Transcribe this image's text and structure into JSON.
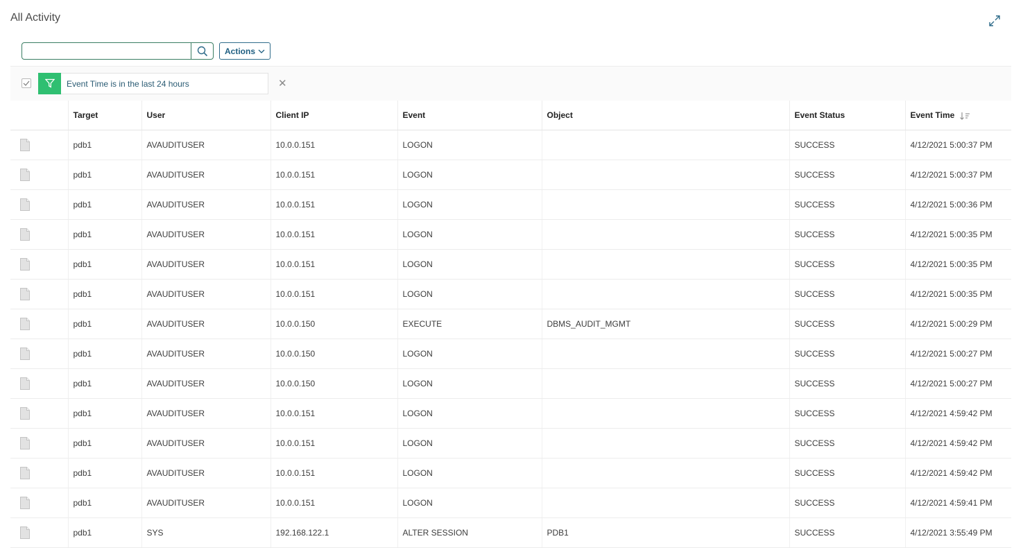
{
  "page": {
    "title": "All Activity"
  },
  "search": {
    "value": "",
    "placeholder": ""
  },
  "actions": {
    "label": "Actions"
  },
  "filter": {
    "text": "Event Time is in the last 24 hours",
    "accent_color": "#2fbf71"
  },
  "table": {
    "columns": [
      "",
      "Target",
      "User",
      "Client IP",
      "Event",
      "Object",
      "Event Status",
      "Event Time"
    ],
    "sorted_column": "Event Time",
    "sort_direction": "descending",
    "rows": [
      {
        "target": "pdb1",
        "user": "AVAUDITUSER",
        "client_ip": "10.0.0.151",
        "event": "LOGON",
        "object": "",
        "status": "SUCCESS",
        "time": "4/12/2021 5:00:37 PM"
      },
      {
        "target": "pdb1",
        "user": "AVAUDITUSER",
        "client_ip": "10.0.0.151",
        "event": "LOGON",
        "object": "",
        "status": "SUCCESS",
        "time": "4/12/2021 5:00:37 PM"
      },
      {
        "target": "pdb1",
        "user": "AVAUDITUSER",
        "client_ip": "10.0.0.151",
        "event": "LOGON",
        "object": "",
        "status": "SUCCESS",
        "time": "4/12/2021 5:00:36 PM"
      },
      {
        "target": "pdb1",
        "user": "AVAUDITUSER",
        "client_ip": "10.0.0.151",
        "event": "LOGON",
        "object": "",
        "status": "SUCCESS",
        "time": "4/12/2021 5:00:35 PM"
      },
      {
        "target": "pdb1",
        "user": "AVAUDITUSER",
        "client_ip": "10.0.0.151",
        "event": "LOGON",
        "object": "",
        "status": "SUCCESS",
        "time": "4/12/2021 5:00:35 PM"
      },
      {
        "target": "pdb1",
        "user": "AVAUDITUSER",
        "client_ip": "10.0.0.151",
        "event": "LOGON",
        "object": "",
        "status": "SUCCESS",
        "time": "4/12/2021 5:00:35 PM"
      },
      {
        "target": "pdb1",
        "user": "AVAUDITUSER",
        "client_ip": "10.0.0.150",
        "event": "EXECUTE",
        "object": "DBMS_AUDIT_MGMT",
        "status": "SUCCESS",
        "time": "4/12/2021 5:00:29 PM"
      },
      {
        "target": "pdb1",
        "user": "AVAUDITUSER",
        "client_ip": "10.0.0.150",
        "event": "LOGON",
        "object": "",
        "status": "SUCCESS",
        "time": "4/12/2021 5:00:27 PM"
      },
      {
        "target": "pdb1",
        "user": "AVAUDITUSER",
        "client_ip": "10.0.0.150",
        "event": "LOGON",
        "object": "",
        "status": "SUCCESS",
        "time": "4/12/2021 5:00:27 PM"
      },
      {
        "target": "pdb1",
        "user": "AVAUDITUSER",
        "client_ip": "10.0.0.151",
        "event": "LOGON",
        "object": "",
        "status": "SUCCESS",
        "time": "4/12/2021 4:59:42 PM"
      },
      {
        "target": "pdb1",
        "user": "AVAUDITUSER",
        "client_ip": "10.0.0.151",
        "event": "LOGON",
        "object": "",
        "status": "SUCCESS",
        "time": "4/12/2021 4:59:42 PM"
      },
      {
        "target": "pdb1",
        "user": "AVAUDITUSER",
        "client_ip": "10.0.0.151",
        "event": "LOGON",
        "object": "",
        "status": "SUCCESS",
        "time": "4/12/2021 4:59:42 PM"
      },
      {
        "target": "pdb1",
        "user": "AVAUDITUSER",
        "client_ip": "10.0.0.151",
        "event": "LOGON",
        "object": "",
        "status": "SUCCESS",
        "time": "4/12/2021 4:59:41 PM"
      },
      {
        "target": "pdb1",
        "user": "SYS",
        "client_ip": "192.168.122.1",
        "event": "ALTER SESSION",
        "object": "PDB1",
        "status": "SUCCESS",
        "time": "4/12/2021 3:55:49 PM"
      }
    ]
  }
}
